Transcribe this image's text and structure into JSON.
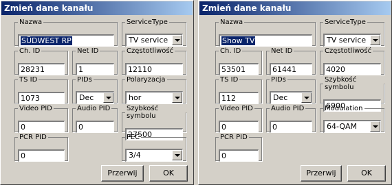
{
  "left": {
    "title": "Zmień dane kanału",
    "nazwa": {
      "label": "Nazwa",
      "value": "SÜDWEST RP"
    },
    "service_type": {
      "label": "ServiceType",
      "value": "TV service"
    },
    "ch_id": {
      "label": "Ch. ID",
      "value": "28231"
    },
    "net_id": {
      "label": "Net ID",
      "value": "1"
    },
    "czestotliwosc": {
      "label": "Częstotliwość",
      "value": "12110"
    },
    "ts_id": {
      "label": "TS ID",
      "value": "1073"
    },
    "pids": {
      "label": "PIDs",
      "value": "Dec"
    },
    "polaryzacja": {
      "label": "Polaryzacja",
      "value": "hor"
    },
    "video_pid": {
      "label": "Video PID",
      "value": "0"
    },
    "audio_pid": {
      "label": "Audio PID",
      "value": "0"
    },
    "szybkosc": {
      "label": "Szybkość symbolu",
      "value": "27500"
    },
    "pcr_pid": {
      "label": "PCR PID",
      "value": "0"
    },
    "fec": {
      "label": "FEC",
      "value": "3/4"
    },
    "cancel": "Przerwij",
    "ok": "OK"
  },
  "right": {
    "title": "Zmień dane kanału",
    "nazwa": {
      "label": "Nazwa",
      "value": "Show TV"
    },
    "service_type": {
      "label": "ServiceType",
      "value": "TV service"
    },
    "ch_id": {
      "label": "Ch. ID",
      "value": "53501"
    },
    "net_id": {
      "label": "Net ID",
      "value": "61441"
    },
    "czestotliwosc": {
      "label": "Częstotliwość",
      "value": "4020"
    },
    "ts_id": {
      "label": "TS ID",
      "value": "112"
    },
    "pids": {
      "label": "PIDs",
      "value": "Dec"
    },
    "szybkosc": {
      "label": "Szybkość symbolu",
      "value": "6900"
    },
    "video_pid": {
      "label": "Video PID",
      "value": "0"
    },
    "audio_pid": {
      "label": "Audio PID",
      "value": "0"
    },
    "modulation": {
      "label": "Modulation",
      "value": "64-QAM"
    },
    "pcr_pid": {
      "label": "PCR PID",
      "value": "0"
    },
    "cancel": "Przerwij",
    "ok": "OK"
  }
}
